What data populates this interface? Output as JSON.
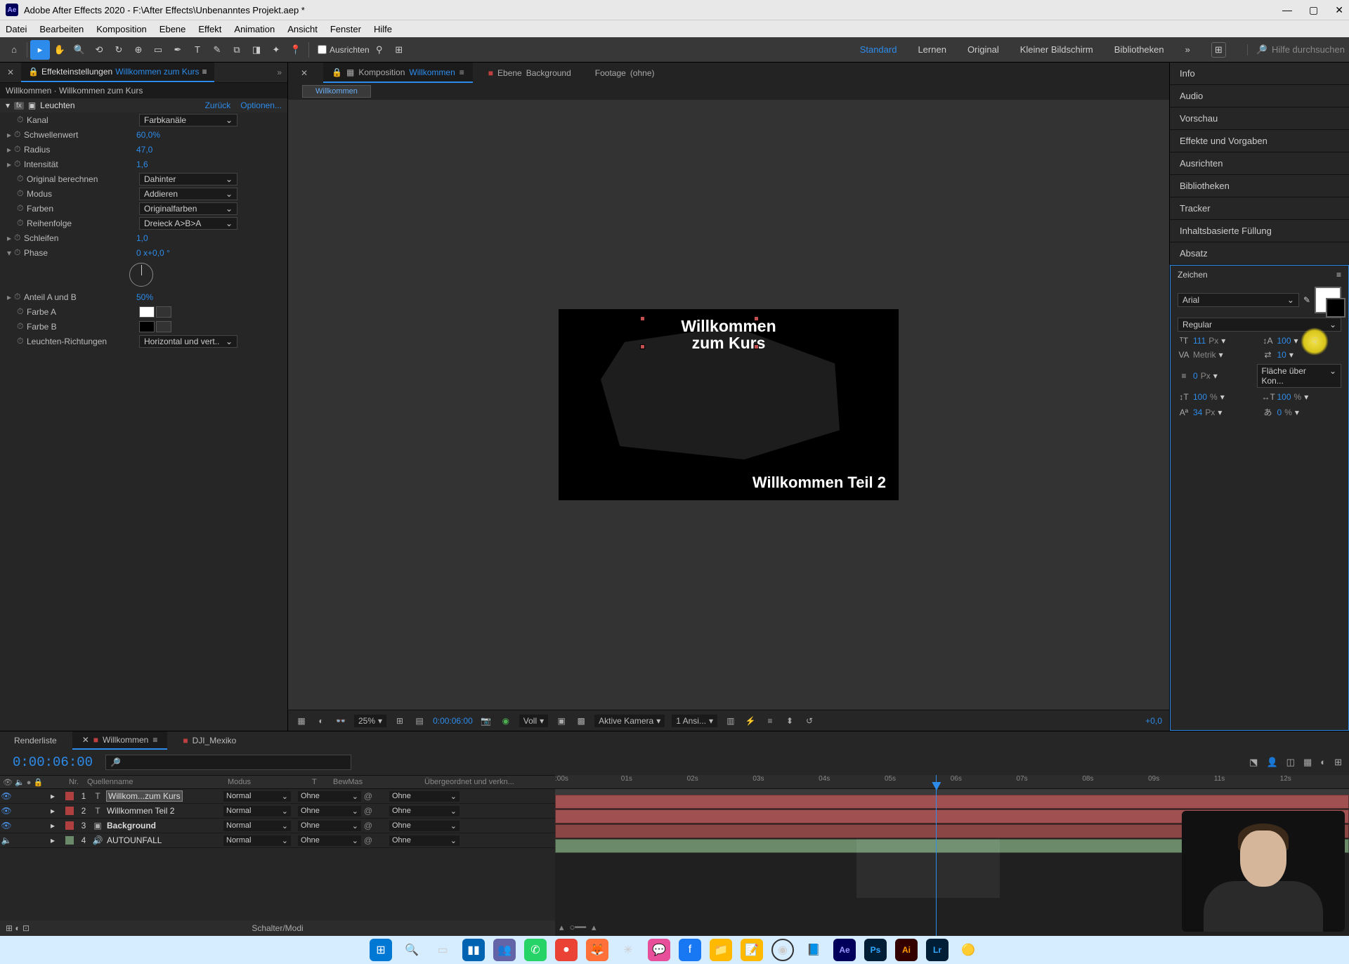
{
  "title": "Adobe After Effects 2020 - F:\\After Effects\\Unbenanntes Projekt.aep *",
  "window_controls": {
    "min": "—",
    "max": "▢",
    "close": "✕"
  },
  "menu": [
    "Datei",
    "Bearbeiten",
    "Komposition",
    "Ebene",
    "Effekt",
    "Animation",
    "Ansicht",
    "Fenster",
    "Hilfe"
  ],
  "toolbar": {
    "align_label": "Ausrichten",
    "workspaces": [
      "Standard",
      "Lernen",
      "Original",
      "Kleiner Bildschirm",
      "Bibliotheken"
    ],
    "search_placeholder": "Hilfe durchsuchen"
  },
  "effect_panel": {
    "tab_prefix": "Effekteinstellungen",
    "tab_layer": "Willkommen zum Kurs",
    "breadcrumb": "Willkommen · Willkommen zum Kurs",
    "fx_name": "Leuchten",
    "link_reset": "Zurück",
    "link_options": "Optionen...",
    "props": [
      {
        "label": "Kanal",
        "type": "dd",
        "value": "Farbkanäle"
      },
      {
        "label": "Schwellenwert",
        "type": "val",
        "value": "60,0",
        "suffix": "%"
      },
      {
        "label": "Radius",
        "type": "val",
        "value": "47,0"
      },
      {
        "label": "Intensität",
        "type": "val",
        "value": "1,6"
      },
      {
        "label": "Original berechnen",
        "type": "dd",
        "value": "Dahinter"
      },
      {
        "label": "Modus",
        "type": "dd",
        "value": "Addieren"
      },
      {
        "label": "Farben",
        "type": "dd",
        "value": "Originalfarben"
      },
      {
        "label": "Reihenfolge",
        "type": "dd",
        "value": "Dreieck A>B>A"
      },
      {
        "label": "Schleifen",
        "type": "val",
        "value": "1,0"
      },
      {
        "label": "Phase",
        "type": "phase",
        "value": "0 x+0,0 °"
      },
      {
        "label": "Anteil A und B",
        "type": "val",
        "value": "50",
        "suffix": "%"
      },
      {
        "label": "Farbe A",
        "type": "color",
        "hex": "#ffffff"
      },
      {
        "label": "Farbe B",
        "type": "color",
        "hex": "#000000"
      },
      {
        "label": "Leuchten-Richtungen",
        "type": "dd",
        "value": "Horizontal und vert.."
      }
    ]
  },
  "comp_panel": {
    "tabs": [
      {
        "kind": "comp",
        "label_prefix": "Komposition",
        "label": "Willkommen",
        "active": true
      },
      {
        "kind": "layer",
        "label_prefix": "Ebene",
        "label": "Background"
      },
      {
        "kind": "footage",
        "label_prefix": "Footage",
        "label": "(ohne)"
      }
    ],
    "flowchart": "Willkommen",
    "text_layer_1": "Willkommen\nzum Kurs",
    "text_layer_2": "Willkommen Teil 2",
    "footer": {
      "zoom": "25%",
      "timecode": "0:00:06:00",
      "res": "Voll",
      "camera": "Aktive Kamera",
      "views": "1 Ansi...",
      "exposure": "+0,0"
    }
  },
  "right_panels": [
    "Info",
    "Audio",
    "Vorschau",
    "Effekte und Vorgaben",
    "Ausrichten",
    "Bibliotheken",
    "Tracker",
    "Inhaltsbasierte Füllung",
    "Absatz"
  ],
  "char_panel": {
    "title": "Zeichen",
    "font": "Arial",
    "style": "Regular",
    "size": "111",
    "size_unit": "Px",
    "leading": "100",
    "kerning": "Metrik",
    "tracking": "10",
    "stroke": "0",
    "stroke_unit": "Px",
    "stroke_mode": "Fläche über Kon...",
    "hscale": "100",
    "vscale": "100",
    "baseline": "34",
    "baseline_unit": "Px",
    "tsume": "0"
  },
  "timeline": {
    "tabs": [
      "Renderliste",
      "Willkommen",
      "DJI_Mexiko"
    ],
    "current_time": "0:00:06:00",
    "columns": {
      "num": "Nr.",
      "name": "Quellenname",
      "mode": "Modus",
      "t": "T",
      "bew": "BewMas",
      "parent": "Übergeordnet und verkn..."
    },
    "mode_value": "Normal",
    "parent_value": "Ohne",
    "switch_label": "Schalter/Modi",
    "ticks": [
      ":00s",
      "01s",
      "02s",
      "03s",
      "04s",
      "05s",
      "06s",
      "07s",
      "08s",
      "09s",
      "11s",
      "12s"
    ],
    "layers": [
      {
        "num": 1,
        "type": "T",
        "name": "Willkom...zum Kurs",
        "selected": true,
        "color": "#b04040"
      },
      {
        "num": 2,
        "type": "T",
        "name": "Willkommen Teil 2",
        "selected": false,
        "color": "#b04040"
      },
      {
        "num": 3,
        "type": "S",
        "name": "Background",
        "selected": false,
        "color": "#b04040",
        "bold": true
      },
      {
        "num": 4,
        "type": "A",
        "name": "AUTOUNFALL",
        "selected": false,
        "color": "#6a8a6a"
      }
    ]
  }
}
